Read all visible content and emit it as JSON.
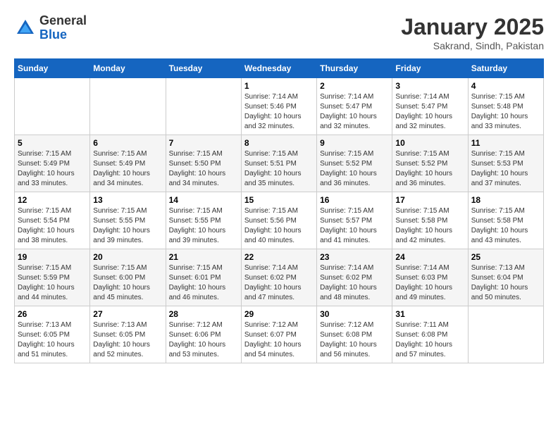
{
  "logo": {
    "general": "General",
    "blue": "Blue"
  },
  "title": "January 2025",
  "location": "Sakrand, Sindh, Pakistan",
  "days_of_week": [
    "Sunday",
    "Monday",
    "Tuesday",
    "Wednesday",
    "Thursday",
    "Friday",
    "Saturday"
  ],
  "weeks": [
    [
      {
        "day": "",
        "info": ""
      },
      {
        "day": "",
        "info": ""
      },
      {
        "day": "",
        "info": ""
      },
      {
        "day": "1",
        "info": "Sunrise: 7:14 AM\nSunset: 5:46 PM\nDaylight: 10 hours\nand 32 minutes."
      },
      {
        "day": "2",
        "info": "Sunrise: 7:14 AM\nSunset: 5:47 PM\nDaylight: 10 hours\nand 32 minutes."
      },
      {
        "day": "3",
        "info": "Sunrise: 7:14 AM\nSunset: 5:47 PM\nDaylight: 10 hours\nand 32 minutes."
      },
      {
        "day": "4",
        "info": "Sunrise: 7:15 AM\nSunset: 5:48 PM\nDaylight: 10 hours\nand 33 minutes."
      }
    ],
    [
      {
        "day": "5",
        "info": "Sunrise: 7:15 AM\nSunset: 5:49 PM\nDaylight: 10 hours\nand 33 minutes."
      },
      {
        "day": "6",
        "info": "Sunrise: 7:15 AM\nSunset: 5:49 PM\nDaylight: 10 hours\nand 34 minutes."
      },
      {
        "day": "7",
        "info": "Sunrise: 7:15 AM\nSunset: 5:50 PM\nDaylight: 10 hours\nand 34 minutes."
      },
      {
        "day": "8",
        "info": "Sunrise: 7:15 AM\nSunset: 5:51 PM\nDaylight: 10 hours\nand 35 minutes."
      },
      {
        "day": "9",
        "info": "Sunrise: 7:15 AM\nSunset: 5:52 PM\nDaylight: 10 hours\nand 36 minutes."
      },
      {
        "day": "10",
        "info": "Sunrise: 7:15 AM\nSunset: 5:52 PM\nDaylight: 10 hours\nand 36 minutes."
      },
      {
        "day": "11",
        "info": "Sunrise: 7:15 AM\nSunset: 5:53 PM\nDaylight: 10 hours\nand 37 minutes."
      }
    ],
    [
      {
        "day": "12",
        "info": "Sunrise: 7:15 AM\nSunset: 5:54 PM\nDaylight: 10 hours\nand 38 minutes."
      },
      {
        "day": "13",
        "info": "Sunrise: 7:15 AM\nSunset: 5:55 PM\nDaylight: 10 hours\nand 39 minutes."
      },
      {
        "day": "14",
        "info": "Sunrise: 7:15 AM\nSunset: 5:55 PM\nDaylight: 10 hours\nand 39 minutes."
      },
      {
        "day": "15",
        "info": "Sunrise: 7:15 AM\nSunset: 5:56 PM\nDaylight: 10 hours\nand 40 minutes."
      },
      {
        "day": "16",
        "info": "Sunrise: 7:15 AM\nSunset: 5:57 PM\nDaylight: 10 hours\nand 41 minutes."
      },
      {
        "day": "17",
        "info": "Sunrise: 7:15 AM\nSunset: 5:58 PM\nDaylight: 10 hours\nand 42 minutes."
      },
      {
        "day": "18",
        "info": "Sunrise: 7:15 AM\nSunset: 5:58 PM\nDaylight: 10 hours\nand 43 minutes."
      }
    ],
    [
      {
        "day": "19",
        "info": "Sunrise: 7:15 AM\nSunset: 5:59 PM\nDaylight: 10 hours\nand 44 minutes."
      },
      {
        "day": "20",
        "info": "Sunrise: 7:15 AM\nSunset: 6:00 PM\nDaylight: 10 hours\nand 45 minutes."
      },
      {
        "day": "21",
        "info": "Sunrise: 7:15 AM\nSunset: 6:01 PM\nDaylight: 10 hours\nand 46 minutes."
      },
      {
        "day": "22",
        "info": "Sunrise: 7:14 AM\nSunset: 6:02 PM\nDaylight: 10 hours\nand 47 minutes."
      },
      {
        "day": "23",
        "info": "Sunrise: 7:14 AM\nSunset: 6:02 PM\nDaylight: 10 hours\nand 48 minutes."
      },
      {
        "day": "24",
        "info": "Sunrise: 7:14 AM\nSunset: 6:03 PM\nDaylight: 10 hours\nand 49 minutes."
      },
      {
        "day": "25",
        "info": "Sunrise: 7:13 AM\nSunset: 6:04 PM\nDaylight: 10 hours\nand 50 minutes."
      }
    ],
    [
      {
        "day": "26",
        "info": "Sunrise: 7:13 AM\nSunset: 6:05 PM\nDaylight: 10 hours\nand 51 minutes."
      },
      {
        "day": "27",
        "info": "Sunrise: 7:13 AM\nSunset: 6:05 PM\nDaylight: 10 hours\nand 52 minutes."
      },
      {
        "day": "28",
        "info": "Sunrise: 7:12 AM\nSunset: 6:06 PM\nDaylight: 10 hours\nand 53 minutes."
      },
      {
        "day": "29",
        "info": "Sunrise: 7:12 AM\nSunset: 6:07 PM\nDaylight: 10 hours\nand 54 minutes."
      },
      {
        "day": "30",
        "info": "Sunrise: 7:12 AM\nSunset: 6:08 PM\nDaylight: 10 hours\nand 56 minutes."
      },
      {
        "day": "31",
        "info": "Sunrise: 7:11 AM\nSunset: 6:08 PM\nDaylight: 10 hours\nand 57 minutes."
      },
      {
        "day": "",
        "info": ""
      }
    ]
  ]
}
